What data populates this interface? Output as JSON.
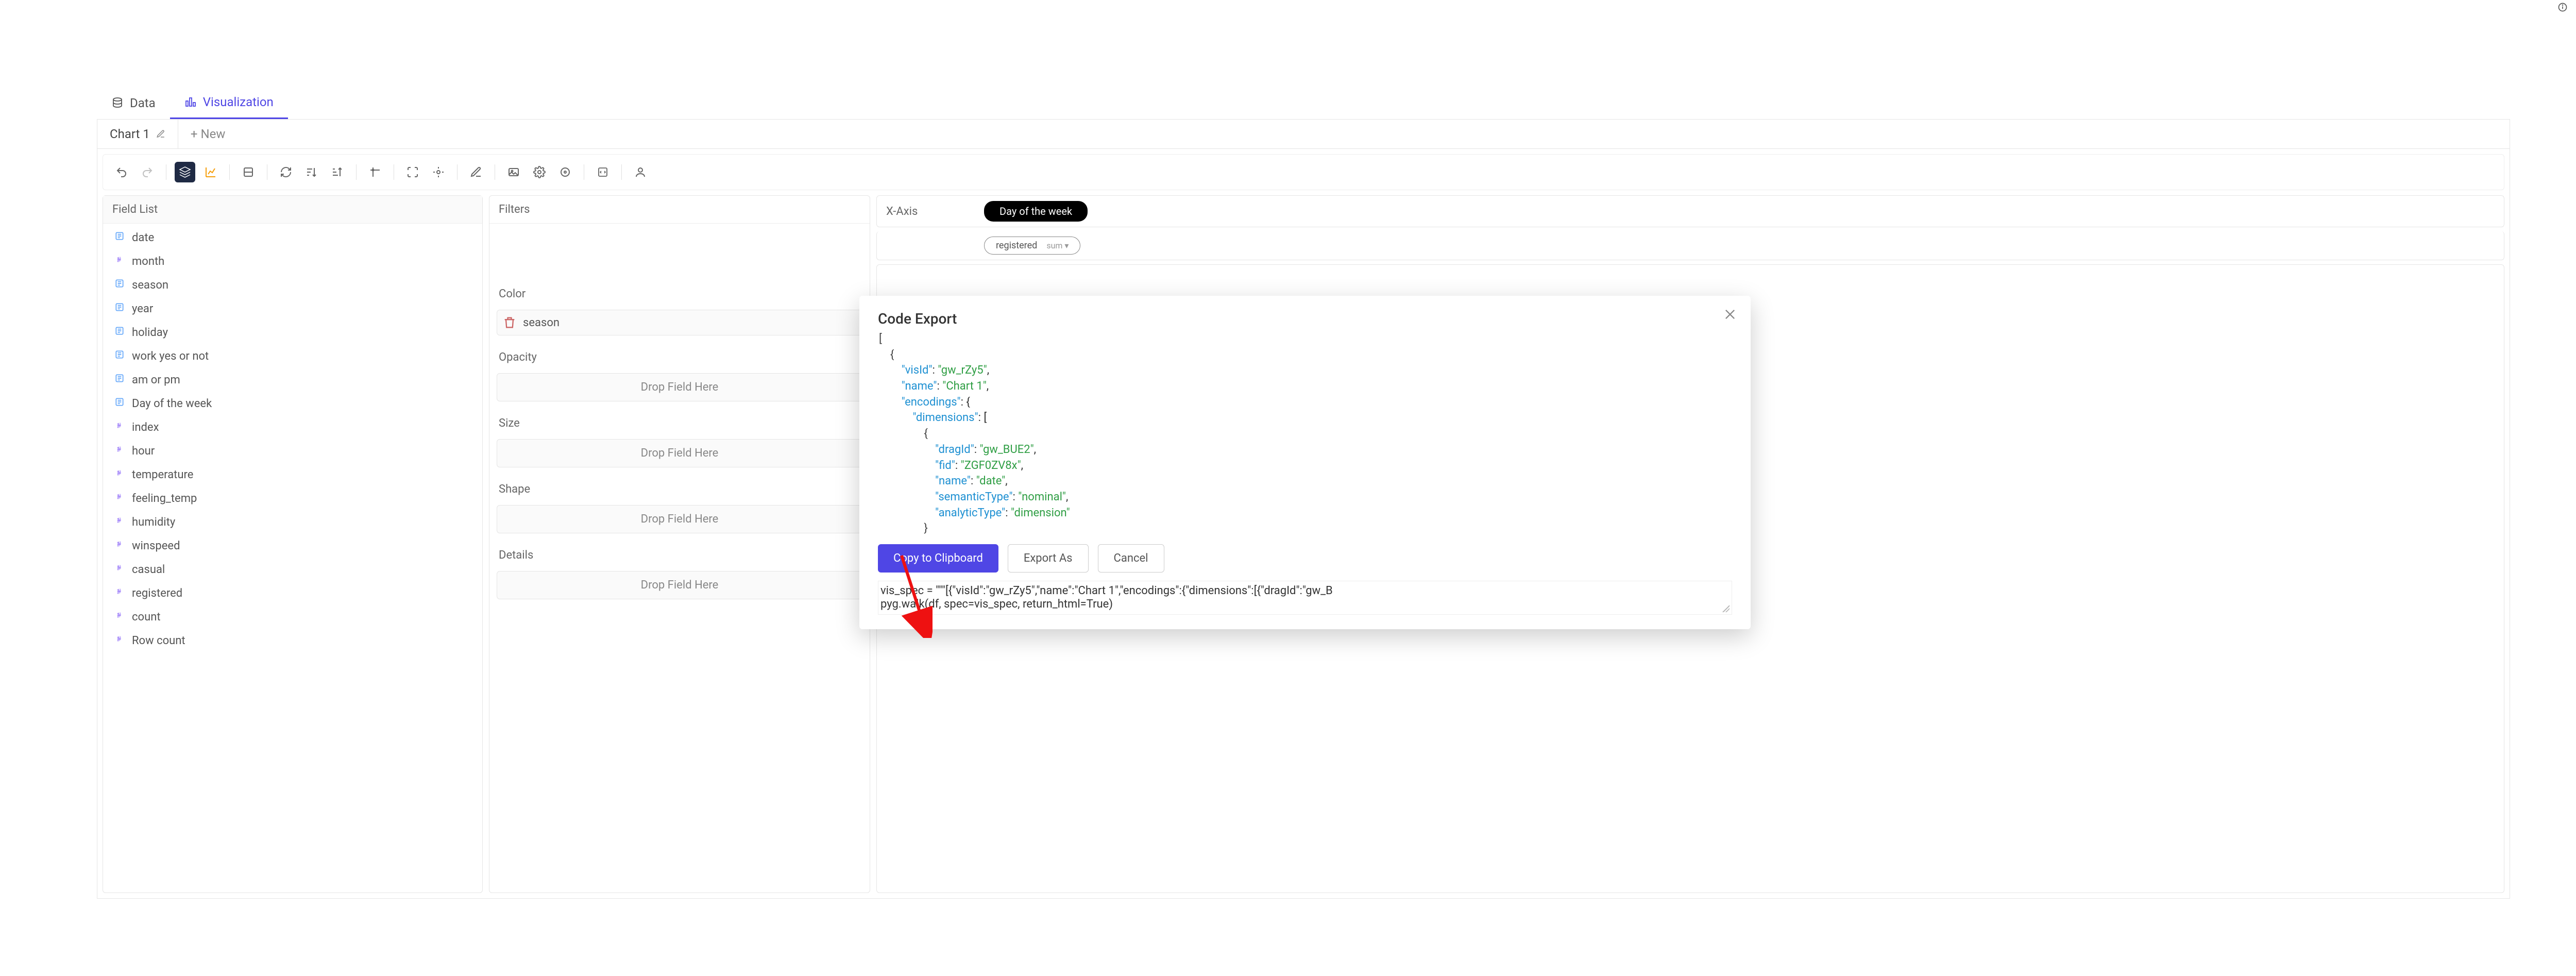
{
  "top_tabs": {
    "data": "Data",
    "visualization": "Visualization"
  },
  "chart_tabs": {
    "chart1": "Chart 1",
    "new_tab": "+ New"
  },
  "field_list": {
    "header": "Field List",
    "items": [
      {
        "name": "date",
        "type": "nominal"
      },
      {
        "name": "month",
        "type": "quant"
      },
      {
        "name": "season",
        "type": "nominal"
      },
      {
        "name": "year",
        "type": "nominal"
      },
      {
        "name": "holiday",
        "type": "nominal"
      },
      {
        "name": "work yes or not",
        "type": "nominal"
      },
      {
        "name": "am or pm",
        "type": "nominal"
      },
      {
        "name": "Day of the week",
        "type": "nominal"
      },
      {
        "name": "index",
        "type": "quant"
      },
      {
        "name": "hour",
        "type": "quant"
      },
      {
        "name": "temperature",
        "type": "quant"
      },
      {
        "name": "feeling_temp",
        "type": "quant"
      },
      {
        "name": "humidity",
        "type": "quant"
      },
      {
        "name": "winspeed",
        "type": "quant"
      },
      {
        "name": "casual",
        "type": "quant"
      },
      {
        "name": "registered",
        "type": "quant"
      },
      {
        "name": "count",
        "type": "quant"
      },
      {
        "name": "Row count",
        "type": "quant"
      }
    ]
  },
  "encodings": {
    "filters": "Filters",
    "color": "Color",
    "color_pill": "season",
    "opacity": "Opacity",
    "size": "Size",
    "shape": "Shape",
    "details": "Details",
    "drop_placeholder": "Drop Field Here"
  },
  "axes": {
    "x_label": "X-Axis",
    "x_pill": "Day of the week",
    "y_pill_field": "registered",
    "y_pill_agg": "sum ▾"
  },
  "modal": {
    "title": "Code Export",
    "copy_btn": "Copy to Clipboard",
    "export_btn": "Export As",
    "cancel_btn": "Cancel",
    "code": {
      "l1": "[",
      "l2": "    {",
      "l3a": "        \"visId\"",
      "l3b": ": ",
      "l3c": "\"gw_rZy5\"",
      "l3d": ",",
      "l4a": "        \"name\"",
      "l4b": ": ",
      "l4c": "\"Chart 1\"",
      "l4d": ",",
      "l5a": "        \"encodings\"",
      "l5b": ": {",
      "l6a": "            \"dimensions\"",
      "l6b": ": [",
      "l7": "                {",
      "l8a": "                    \"dragId\"",
      "l8b": ": ",
      "l8c": "\"gw_BUE2\"",
      "l8d": ",",
      "l9a": "                    \"fid\"",
      "l9b": ": ",
      "l9c": "\"ZGF0ZV8x\"",
      "l9d": ",",
      "l10a": "                    \"name\"",
      "l10b": ": ",
      "l10c": "\"date\"",
      "l10d": ",",
      "l11a": "                    \"semanticType\"",
      "l11b": ": ",
      "l11c": "\"nominal\"",
      "l11d": ",",
      "l12a": "                    \"analyticType\"",
      "l12b": ": ",
      "l12c": "\"dimension\"",
      "l13": "                }"
    },
    "output_line1": "vis_spec = \"\"\"[{\"visId\":\"gw_rZy5\",\"name\":\"Chart 1\",\"encodings\":{\"dimensions\":[{\"dragId\":\"gw_B",
    "output_line2": "pyg.walk(df, spec=vis_spec, return_html=True)"
  }
}
